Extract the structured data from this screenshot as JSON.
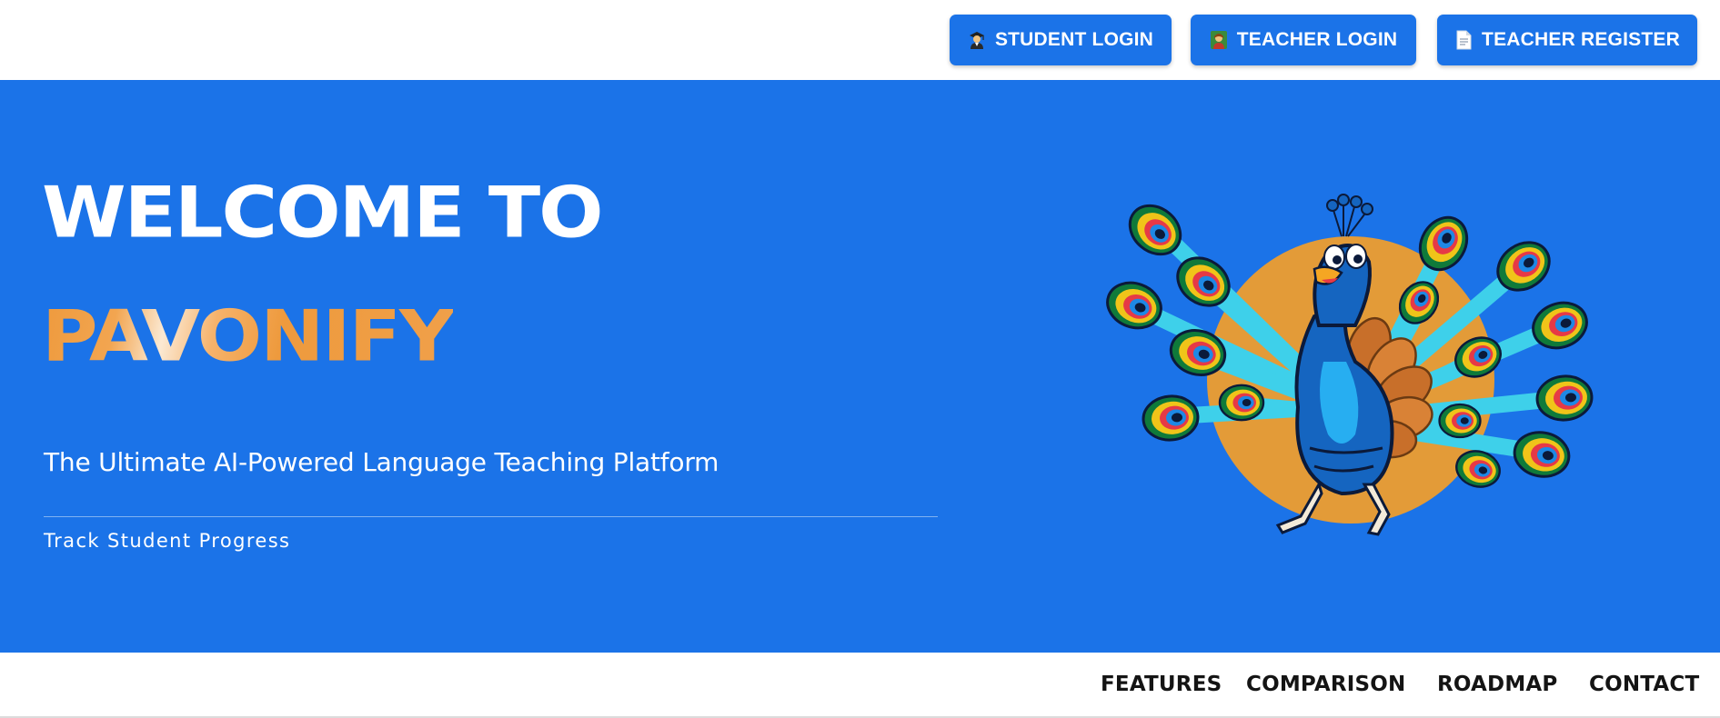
{
  "header": {
    "buttons": [
      {
        "label": "STUDENT LOGIN",
        "icon": "graduate-icon"
      },
      {
        "label": "TEACHER LOGIN",
        "icon": "teacher-icon"
      },
      {
        "label": "TEACHER REGISTER",
        "icon": "document-icon"
      }
    ]
  },
  "hero": {
    "title": "WELCOME TO",
    "brand": "PAVONIFY",
    "subtitle": "The Ultimate AI-Powered Language Teaching Platform",
    "tagline": "Track Student Progress",
    "mascot": "peacock-mascot"
  },
  "nav": {
    "items": [
      "FEATURES",
      "COMPARISON",
      "ROADMAP",
      "CONTACT"
    ]
  },
  "colors": {
    "primary": "#1b73e8",
    "brand_orange": "#ee9a3d",
    "white": "#ffffff",
    "nav_text": "#141414"
  }
}
